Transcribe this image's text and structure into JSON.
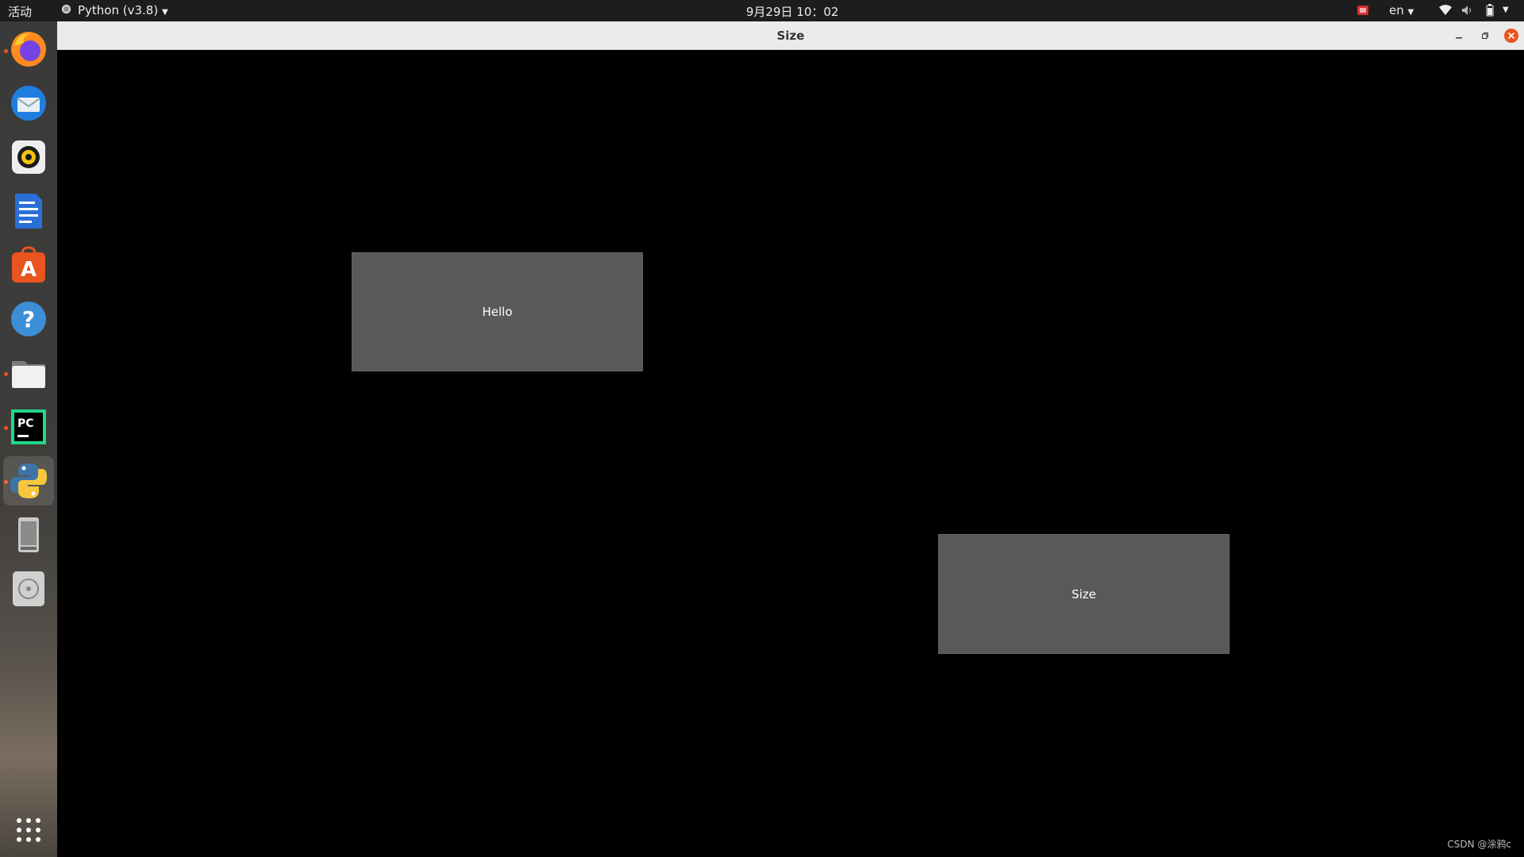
{
  "topbar": {
    "activities": "活动",
    "app_menu": "Python (v3.8)",
    "clock": "9月29日  10：02",
    "language": "en"
  },
  "dock": {
    "items": [
      {
        "name": "firefox-icon",
        "running": true
      },
      {
        "name": "thunderbird-icon",
        "running": false
      },
      {
        "name": "rhythmbox-icon",
        "running": false
      },
      {
        "name": "libreoffice-writer-icon",
        "running": false
      },
      {
        "name": "software-center-icon",
        "running": false
      },
      {
        "name": "help-icon",
        "running": false
      },
      {
        "name": "files-icon",
        "running": true
      },
      {
        "name": "pycharm-icon",
        "running": true
      },
      {
        "name": "python-icon",
        "running": true
      },
      {
        "name": "drive-icon",
        "running": false
      },
      {
        "name": "disc-icon",
        "running": false
      }
    ],
    "show_apps_icon": "grid-icon"
  },
  "window": {
    "title": "Size",
    "buttons": {
      "hello_label": "Hello",
      "size_label": "Size"
    }
  },
  "watermark": "CSDN @涂鸦c",
  "colors": {
    "ubuntu_orange": "#e95420",
    "button_gray": "#595959",
    "close_red": "#e95420"
  }
}
